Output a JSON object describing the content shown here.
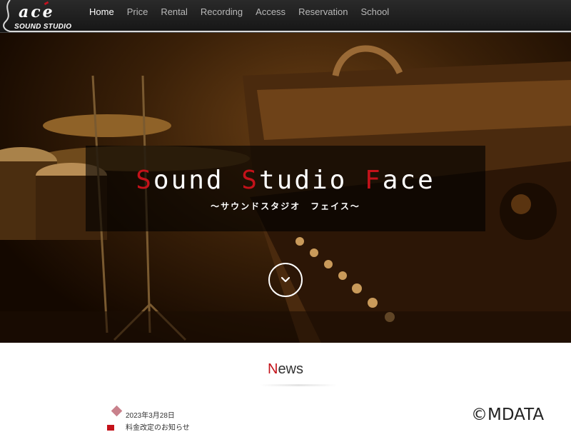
{
  "logo": {
    "main": "ace",
    "sub": "SOUND STUDIO"
  },
  "nav": {
    "items": [
      {
        "label": "Home",
        "active": true
      },
      {
        "label": "Price",
        "active": false
      },
      {
        "label": "Rental",
        "active": false
      },
      {
        "label": "Recording",
        "active": false
      },
      {
        "label": "Access",
        "active": false
      },
      {
        "label": "Reservation",
        "active": false
      },
      {
        "label": "School",
        "active": false
      }
    ]
  },
  "hero": {
    "title_parts": [
      {
        "cap": "S",
        "rest": "ound"
      },
      {
        "cap": "S",
        "rest": "tudio"
      },
      {
        "cap": "F",
        "rest": "ace"
      }
    ],
    "subtitle": "～サウンドスタジオ　フェイス～",
    "scroll_icon": "chevron-down-icon"
  },
  "news": {
    "heading_cap": "N",
    "heading_rest": "ews",
    "items": [
      {
        "date": "2023年3月28日",
        "text": "料金改定のお知らせ"
      }
    ]
  },
  "watermark": "©MDATA",
  "colors": {
    "accent": "#c4121a",
    "nav_bg": "#1e1e1e",
    "diamond": "#c9818c"
  }
}
